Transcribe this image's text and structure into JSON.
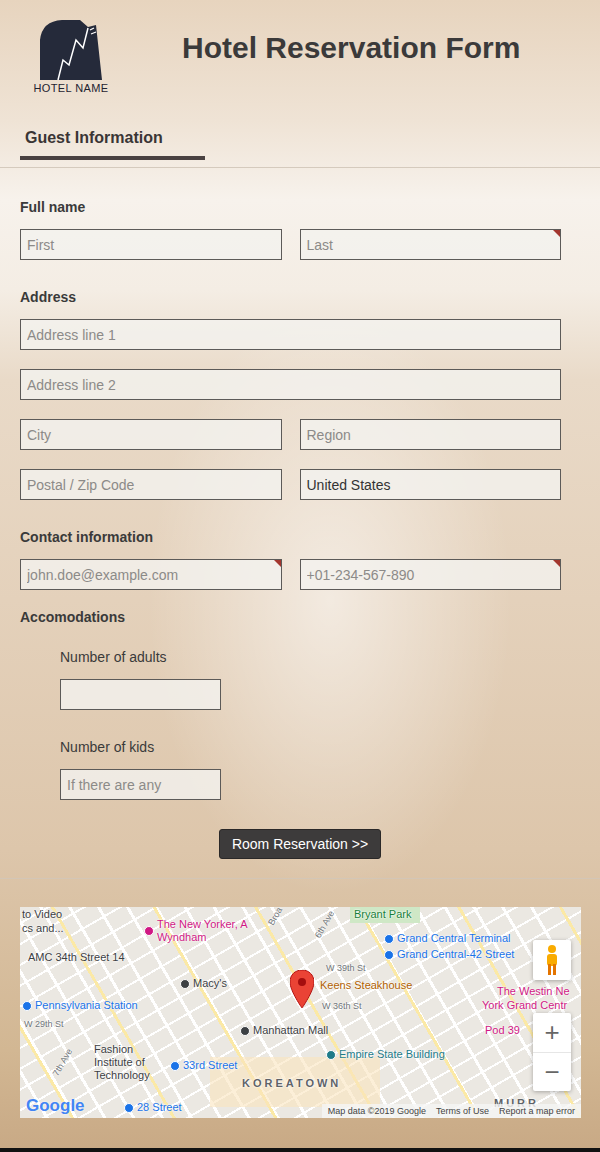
{
  "header": {
    "logo": "HOTEL NAME",
    "title": "Hotel Reservation Form"
  },
  "tabs": [
    {
      "label": "Guest Information",
      "selected": true
    }
  ],
  "sections": [
    {
      "label": "Full name",
      "rows": [
        [
          {
            "placeholder": "First",
            "value": "",
            "required": false
          },
          {
            "placeholder": "Last",
            "value": "",
            "required": true
          }
        ]
      ]
    },
    {
      "label": "Address",
      "rows": [
        [
          {
            "placeholder": "Address line 1",
            "value": "",
            "required": false
          }
        ],
        [
          {
            "placeholder": "Address line 2",
            "value": "",
            "required": false
          }
        ],
        [
          {
            "placeholder": "City",
            "value": "",
            "required": false
          },
          {
            "placeholder": "Region",
            "value": "",
            "required": false
          }
        ],
        [
          {
            "placeholder": "Postal / Zip Code",
            "value": "",
            "required": false
          },
          {
            "placeholder": "",
            "value": "United States",
            "required": false
          }
        ]
      ]
    },
    {
      "label": "Contact information",
      "rows": [
        [
          {
            "placeholder": "john.doe@example.com",
            "value": "",
            "required": true
          },
          {
            "placeholder": "+01-234-567-890",
            "value": "",
            "required": true
          }
        ]
      ]
    }
  ],
  "accommodations": {
    "label": "Accomodations",
    "fields": [
      {
        "label": "Number of adults",
        "placeholder": "",
        "value": ""
      },
      {
        "label": "Number of kids",
        "placeholder": "If there are any",
        "value": ""
      }
    ]
  },
  "button": "Room Reservation >>",
  "map": {
    "labels": [
      {
        "text": "to Video",
        "kind": "place",
        "color": "#3c4043"
      },
      {
        "text": "cs and...",
        "kind": "place",
        "color": "#3c4043"
      },
      {
        "text": "The New Yorker, A Wyndham",
        "kind": "poi",
        "color": "#d01884"
      },
      {
        "text": "Bryant Park",
        "kind": "place",
        "color": "#188038"
      },
      {
        "text": "AMC 34th Street 14",
        "kind": "place",
        "color": "#3c4043"
      },
      {
        "text": "Grand Central Terminal",
        "kind": "poi",
        "color": "#1a73e8"
      },
      {
        "text": "Grand Central-42 Street",
        "kind": "poi",
        "color": "#1a73e8"
      },
      {
        "text": "Macy's",
        "kind": "poi",
        "color": "#3c4043"
      },
      {
        "text": "Keens Steakhouse",
        "kind": "place",
        "color": "#b06000"
      },
      {
        "text": "The Westin Ne",
        "kind": "place",
        "color": "#d01884"
      },
      {
        "text": "York Grand Centr",
        "kind": "place",
        "color": "#d01884"
      },
      {
        "text": "Pennsylvania Station",
        "kind": "poi",
        "color": "#1a73e8"
      },
      {
        "text": "Manhattan Mall",
        "kind": "poi",
        "color": "#3c4043"
      },
      {
        "text": "Pod 39",
        "kind": "place",
        "color": "#d01884"
      },
      {
        "text": "Fashion Institute of Technology",
        "kind": "place",
        "color": "#3c4043"
      },
      {
        "text": "Empire State Building",
        "kind": "poi",
        "color": "#1e7b8a"
      },
      {
        "text": "33rd Street",
        "kind": "poi",
        "color": "#1a73e8"
      },
      {
        "text": "KOREATOWN",
        "kind": "district",
        "color": "#5f6368"
      },
      {
        "text": "MURR",
        "kind": "district",
        "color": "#5f6368"
      },
      {
        "text": "28 Street",
        "kind": "poi",
        "color": "#1a73e8"
      },
      {
        "text": "6th Ave",
        "kind": "street",
        "color": "#70757a"
      },
      {
        "text": "W 39th St",
        "kind": "street",
        "color": "#70757a"
      },
      {
        "text": "W 36th St",
        "kind": "street",
        "color": "#70757a"
      },
      {
        "text": "W 29th St",
        "kind": "street",
        "color": "#70757a"
      },
      {
        "text": "7th Ave",
        "kind": "street",
        "color": "#70757a"
      },
      {
        "text": "Broa",
        "kind": "street",
        "color": "#70757a"
      }
    ],
    "brand": "Google",
    "footer": [
      "Map data ©2019 Google",
      "Terms of Use",
      "Report a map error"
    ],
    "zoom": [
      "+",
      "−"
    ]
  }
}
